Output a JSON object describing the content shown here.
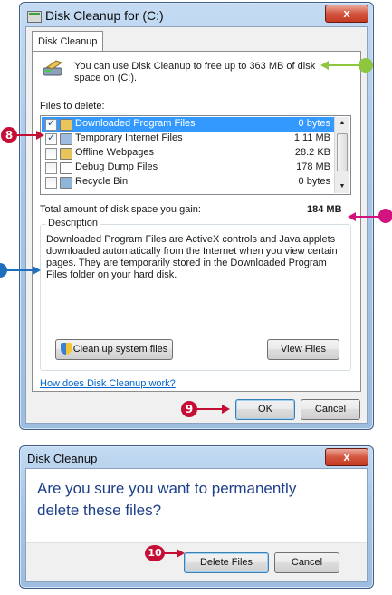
{
  "dialog1": {
    "title": "Disk Cleanup for  (C:)",
    "close_label": "x",
    "tab_label": "Disk Cleanup",
    "intro": "You can use Disk Cleanup to free up to 363 MB of disk",
    "intro_line2": "space on  (C:).",
    "files_to_delete_label": "Files to delete:",
    "files": [
      {
        "name": "Downloaded Program Files",
        "size": "0 bytes",
        "checked": true,
        "selected": true,
        "icon": "folder-icon"
      },
      {
        "name": "Temporary Internet Files",
        "size": "1.11 MB",
        "checked": true,
        "selected": false,
        "icon": "document-icon"
      },
      {
        "name": "Offline Webpages",
        "size": "28.2 KB",
        "checked": false,
        "selected": false,
        "icon": "folder-icon"
      },
      {
        "name": "Debug Dump Files",
        "size": "178 MB",
        "checked": false,
        "selected": false,
        "icon": "blank-icon"
      },
      {
        "name": "Recycle Bin",
        "size": "0 bytes",
        "checked": false,
        "selected": false,
        "icon": "recycle-bin-icon"
      }
    ],
    "total_label": "Total amount of disk space you gain:",
    "total_value": "184 MB",
    "description_legend": "Description",
    "description_text": "Downloaded Program Files are ActiveX controls and Java applets downloaded automatically from the Internet when you view certain pages. They are temporarily stored in the Downloaded Program Files folder on your hard disk.",
    "cleanup_system_label": "Clean up system files",
    "view_files_label": "View Files",
    "help_link": "How does Disk Cleanup work?",
    "ok_label": "OK",
    "cancel_label": "Cancel"
  },
  "dialog2": {
    "title": "Disk Cleanup",
    "close_label": "x",
    "question": "Are you sure you want to permanently delete these files?",
    "delete_label": "Delete Files",
    "cancel_label": "Cancel"
  },
  "callouts": {
    "step8": "8",
    "step9": "9",
    "step10": "10"
  },
  "colors": {
    "callout_red": "#c40e35",
    "callout_green": "#8dc63f",
    "callout_magenta": "#d1127f",
    "callout_blue": "#1f6fbf"
  }
}
